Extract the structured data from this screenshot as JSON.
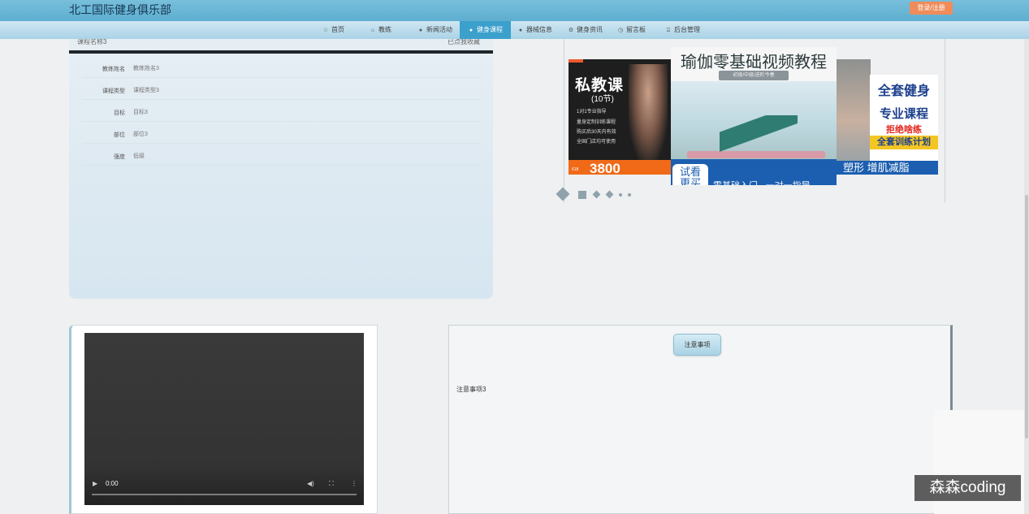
{
  "header": {
    "brand": "北工国际健身俱乐部",
    "login_button": "登录/注册"
  },
  "nav": {
    "items": [
      {
        "label": "首页",
        "icon": "star-icon"
      },
      {
        "label": "教练",
        "icon": "home-icon"
      },
      {
        "label": "新闻活动",
        "icon": "info-icon"
      },
      {
        "label": "健身课程",
        "icon": "dot-icon",
        "active": true
      },
      {
        "label": "器械信息",
        "icon": "info-icon"
      },
      {
        "label": "健身资讯",
        "icon": "gear-icon"
      },
      {
        "label": "留言板",
        "icon": "clock-icon"
      },
      {
        "label": "后台管理",
        "icon": "lock-icon"
      }
    ],
    "active_color": "#3ba0cc"
  },
  "course": {
    "name": "课程名称3",
    "favorite": "已点我收藏",
    "fields": [
      {
        "label": "教练姓名",
        "value": "教练姓名3"
      },
      {
        "label": "课程类型",
        "value": "课程类型3"
      },
      {
        "label": "目标",
        "value": "目标3"
      },
      {
        "label": "部位",
        "value": "部位3"
      },
      {
        "label": "强度",
        "value": "低级"
      }
    ]
  },
  "banner": {
    "left": {
      "title": "私教课",
      "subtitle": "(10节)",
      "lines": [
        "1对1专业指导",
        "量身定制训练课程",
        "购买后30天内有效",
        "全国门店均可使用"
      ],
      "price": "3800",
      "tag": "618"
    },
    "middle": {
      "title": "瑜伽零基础视频教程",
      "subtitle": "初级/中级/进阶今春",
      "try_label": "试看\n更买",
      "tip": "零基础入门 · 一对一指导"
    },
    "right": {
      "line1": "全套健身",
      "line2": "专业课程",
      "line3": "拒绝啥练",
      "line4": "全套训练计划",
      "tagline": "塑形 增肌减脂"
    }
  },
  "video": {
    "time": "0:00",
    "play_icon": "play-icon",
    "volume_icon": "volume-icon",
    "fullscreen_icon": "fullscreen-icon",
    "more_icon": "more-icon"
  },
  "notes": {
    "badge": "注意事项",
    "text": "注意事项3"
  },
  "watermark": "森森coding"
}
